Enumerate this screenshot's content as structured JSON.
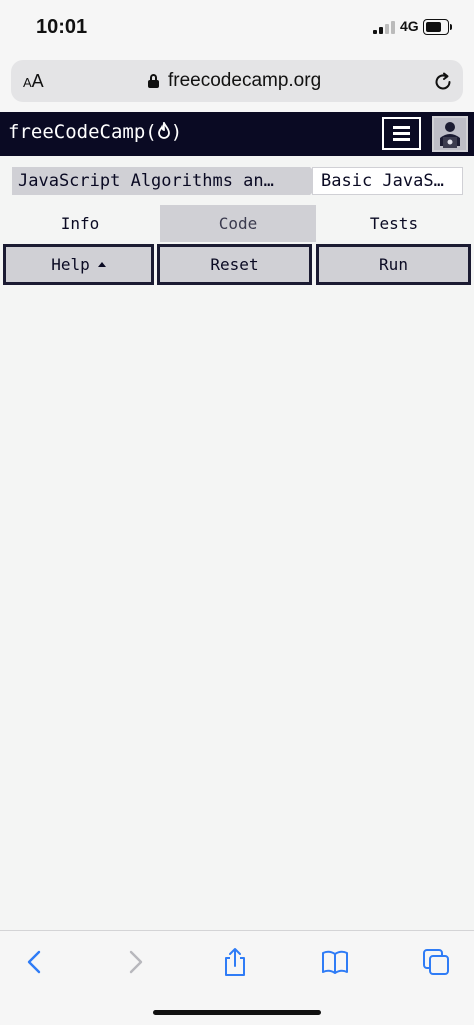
{
  "status_bar": {
    "time": "10:01",
    "network": "4G",
    "battery_level": 0.75
  },
  "browser": {
    "text_size_label_small": "A",
    "text_size_label_large": "A",
    "url": "freecodecamp.org",
    "icons": [
      "lock-icon",
      "reload-icon"
    ]
  },
  "fcc_nav": {
    "logo_text": "freeCodeCamp(",
    "logo_end": ")",
    "icons": [
      "flame-icon",
      "menu-icon",
      "avatar"
    ]
  },
  "breadcrumb": {
    "superblock": "JavaScript Algorithms an…",
    "block": "Basic JavaS…"
  },
  "tabs": [
    {
      "label": "Info",
      "active": false
    },
    {
      "label": "Code",
      "active": true
    },
    {
      "label": "Tests",
      "active": false
    }
  ],
  "actions": {
    "help_label": "Help",
    "reset_label": "Reset",
    "run_label": "Run"
  },
  "toolbar": {
    "icons": [
      "back-icon",
      "forward-icon",
      "share-icon",
      "bookmarks-icon",
      "tabs-icon"
    ]
  },
  "colors": {
    "nav_bg": "#0a0a23",
    "button_bg": "#d0d0d5",
    "ios_blue": "#2f7cf6"
  }
}
